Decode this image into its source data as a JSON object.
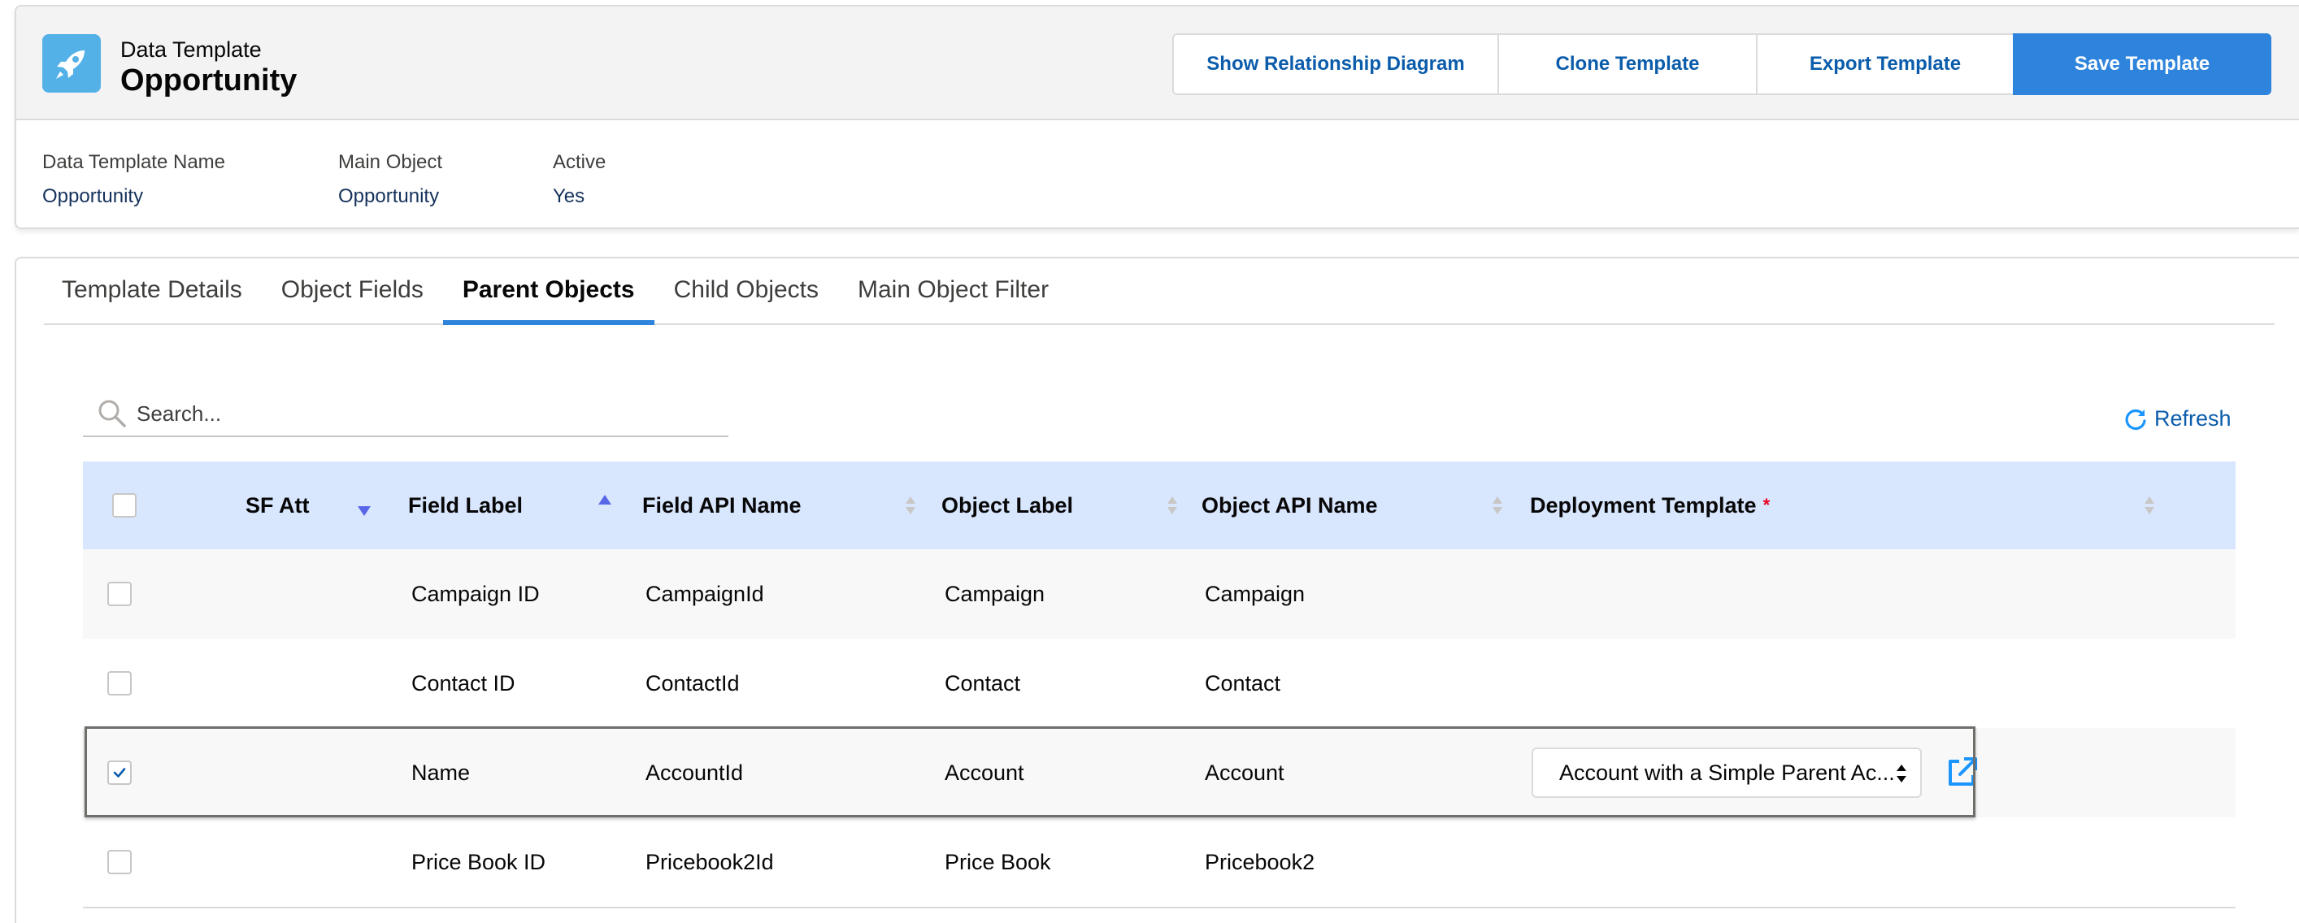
{
  "header": {
    "eyebrow": "Data Template",
    "title": "Opportunity",
    "icon": "rocket-icon",
    "accent_color": "#54b1e8",
    "buttons": [
      {
        "label": "Show Relationship Diagram"
      },
      {
        "label": "Clone Template"
      },
      {
        "label": "Export Template"
      },
      {
        "label": "Save Template",
        "variant": "brand",
        "color": "#2e84dc"
      }
    ]
  },
  "highlights": [
    {
      "label": "Data Template Name",
      "value": "Opportunity"
    },
    {
      "label": "Main Object",
      "value": "Opportunity"
    },
    {
      "label": "Active",
      "value": "Yes"
    }
  ],
  "tabs": [
    {
      "label": "Template Details"
    },
    {
      "label": "Object Fields"
    },
    {
      "label": "Parent Objects",
      "active": true
    },
    {
      "label": "Child Objects"
    },
    {
      "label": "Main Object Filter"
    }
  ],
  "search": {
    "placeholder": "Search...",
    "value": ""
  },
  "refresh_label": "Refresh",
  "table": {
    "columns": [
      {
        "label": "SF Att",
        "sort": "desc"
      },
      {
        "label": "Field Label",
        "sort": "asc"
      },
      {
        "label": "Field API Name",
        "sort": "none"
      },
      {
        "label": "Object Label",
        "sort": "none"
      },
      {
        "label": "Object API Name",
        "sort": "none"
      },
      {
        "label": "Deployment Template",
        "required": true,
        "required_marker": "*",
        "sort": "none"
      }
    ],
    "rows": [
      {
        "checked": false,
        "field_label": "Campaign ID",
        "field_api_name": "CampaignId",
        "object_label": "Campaign",
        "object_api_name": "Campaign",
        "deployment_template": ""
      },
      {
        "checked": false,
        "field_label": "Contact ID",
        "field_api_name": "ContactId",
        "object_label": "Contact",
        "object_api_name": "Contact",
        "deployment_template": ""
      },
      {
        "checked": true,
        "field_label": "Name",
        "field_api_name": "AccountId",
        "object_label": "Account",
        "object_api_name": "Account",
        "deployment_template": "Account with a Simple Parent Ac..."
      },
      {
        "checked": false,
        "field_label": "Price Book ID",
        "field_api_name": "Pricebook2Id",
        "object_label": "Price Book",
        "object_api_name": "Pricebook2",
        "deployment_template": ""
      }
    ]
  }
}
